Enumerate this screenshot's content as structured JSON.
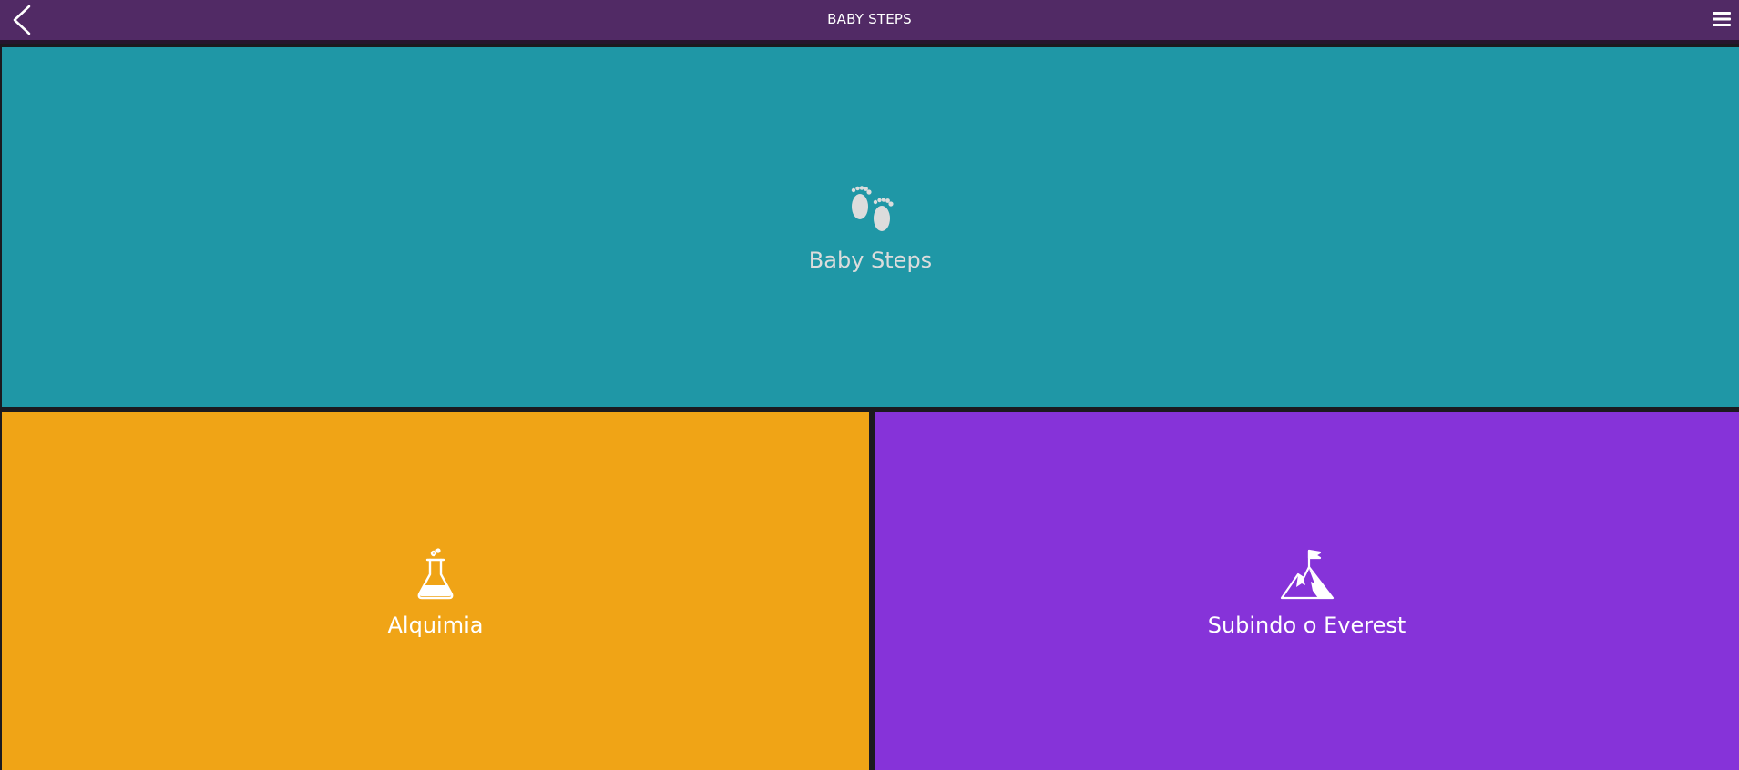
{
  "header": {
    "title": "BABY STEPS",
    "back_icon": "chevron-left-icon",
    "menu_icon": "hamburger-menu-icon"
  },
  "tiles": [
    {
      "label": "Baby Steps",
      "icon": "footprints-icon",
      "color": "#1f97a6"
    },
    {
      "label": "Alquimia",
      "icon": "flask-icon",
      "color": "#f0a416"
    },
    {
      "label": "Subindo o Everest",
      "icon": "mountain-flag-icon",
      "color": "#8633d9"
    }
  ],
  "colors": {
    "header": "#512a65",
    "background": "#1b1a1f"
  }
}
